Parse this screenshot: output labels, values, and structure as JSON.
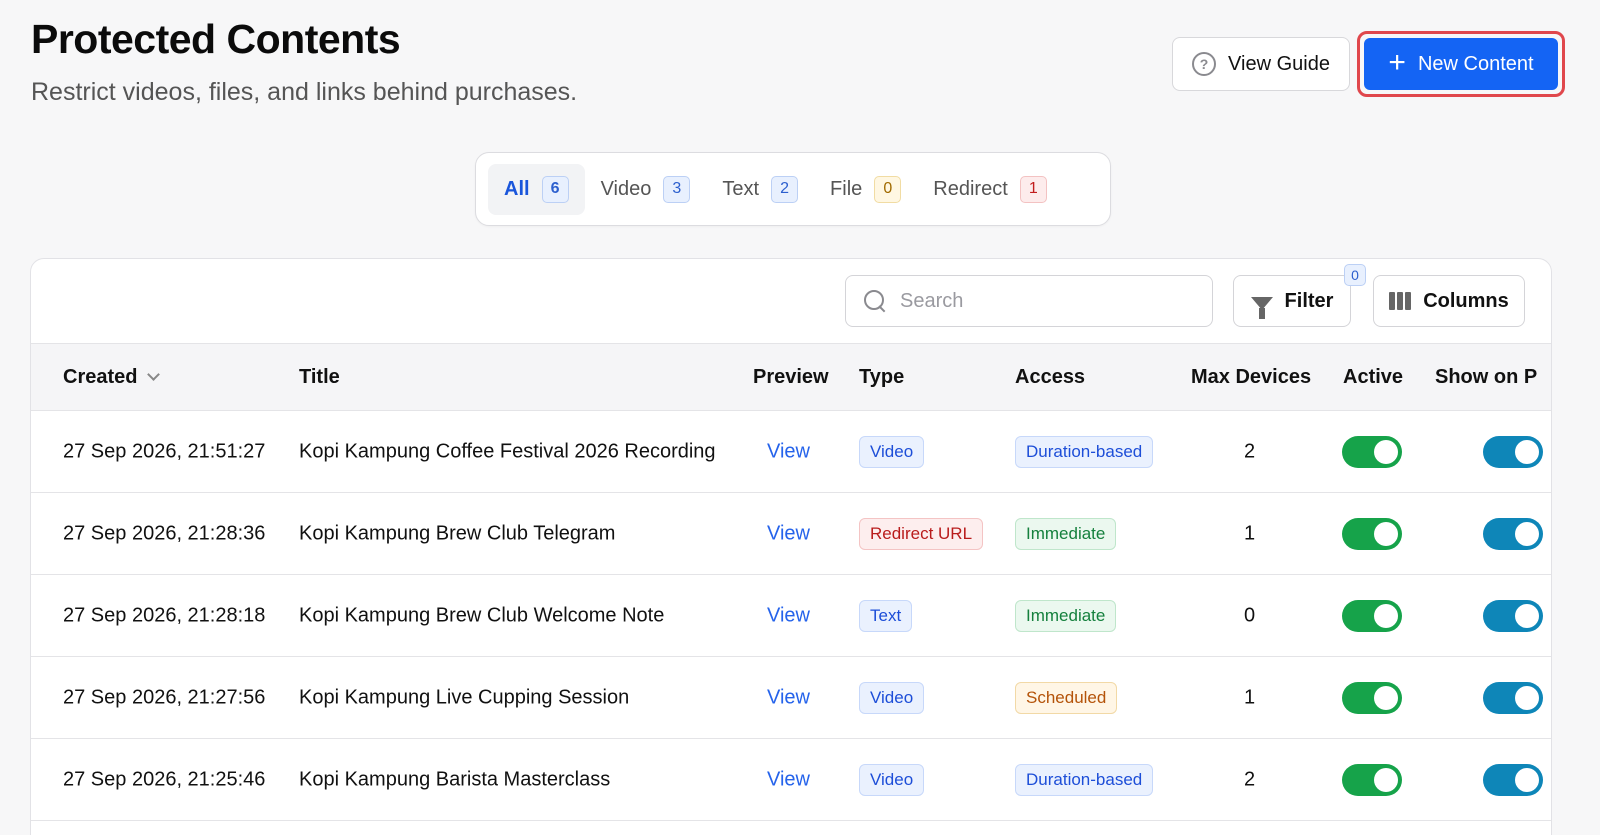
{
  "header": {
    "title": "Protected Contents",
    "subtitle": "Restrict videos, files, and links behind purchases.",
    "view_guide_label": "View Guide",
    "new_content_label": "New Content"
  },
  "tabs": [
    {
      "label": "All",
      "count": "6"
    },
    {
      "label": "Video",
      "count": "3"
    },
    {
      "label": "Text",
      "count": "2"
    },
    {
      "label": "File",
      "count": "0"
    },
    {
      "label": "Redirect",
      "count": "1"
    }
  ],
  "toolbar": {
    "search_placeholder": "Search",
    "filter_label": "Filter",
    "filter_count": "0",
    "columns_label": "Columns"
  },
  "table": {
    "headers": {
      "created": "Created",
      "title": "Title",
      "preview": "Preview",
      "type": "Type",
      "access": "Access",
      "max_devices": "Max Devices",
      "active": "Active",
      "show_on": "Show on P"
    },
    "rows": [
      {
        "created": "27 Sep 2026, 21:51:27",
        "title": "Kopi Kampung Coffee Festival 2026 Recording",
        "preview": "View",
        "type": "Video",
        "access": "Duration-based",
        "max_devices": "2"
      },
      {
        "created": "27 Sep 2026, 21:28:36",
        "title": "Kopi Kampung Brew Club Telegram",
        "preview": "View",
        "type": "Redirect URL",
        "access": "Immediate",
        "max_devices": "1"
      },
      {
        "created": "27 Sep 2026, 21:28:18",
        "title": "Kopi Kampung Brew Club Welcome Note",
        "preview": "View",
        "type": "Text",
        "access": "Immediate",
        "max_devices": "0"
      },
      {
        "created": "27 Sep 2026, 21:27:56",
        "title": "Kopi Kampung Live Cupping Session",
        "preview": "View",
        "type": "Video",
        "access": "Scheduled",
        "max_devices": "1"
      },
      {
        "created": "27 Sep 2026, 21:25:46",
        "title": "Kopi Kampung Barista Masterclass",
        "preview": "View",
        "type": "Video",
        "access": "Duration-based",
        "max_devices": "2"
      }
    ]
  },
  "colors": {
    "primary": "#1464f4",
    "highlight_border": "#e0474c",
    "toggle_active": "#16a34a",
    "toggle_show": "#0e86b8"
  }
}
